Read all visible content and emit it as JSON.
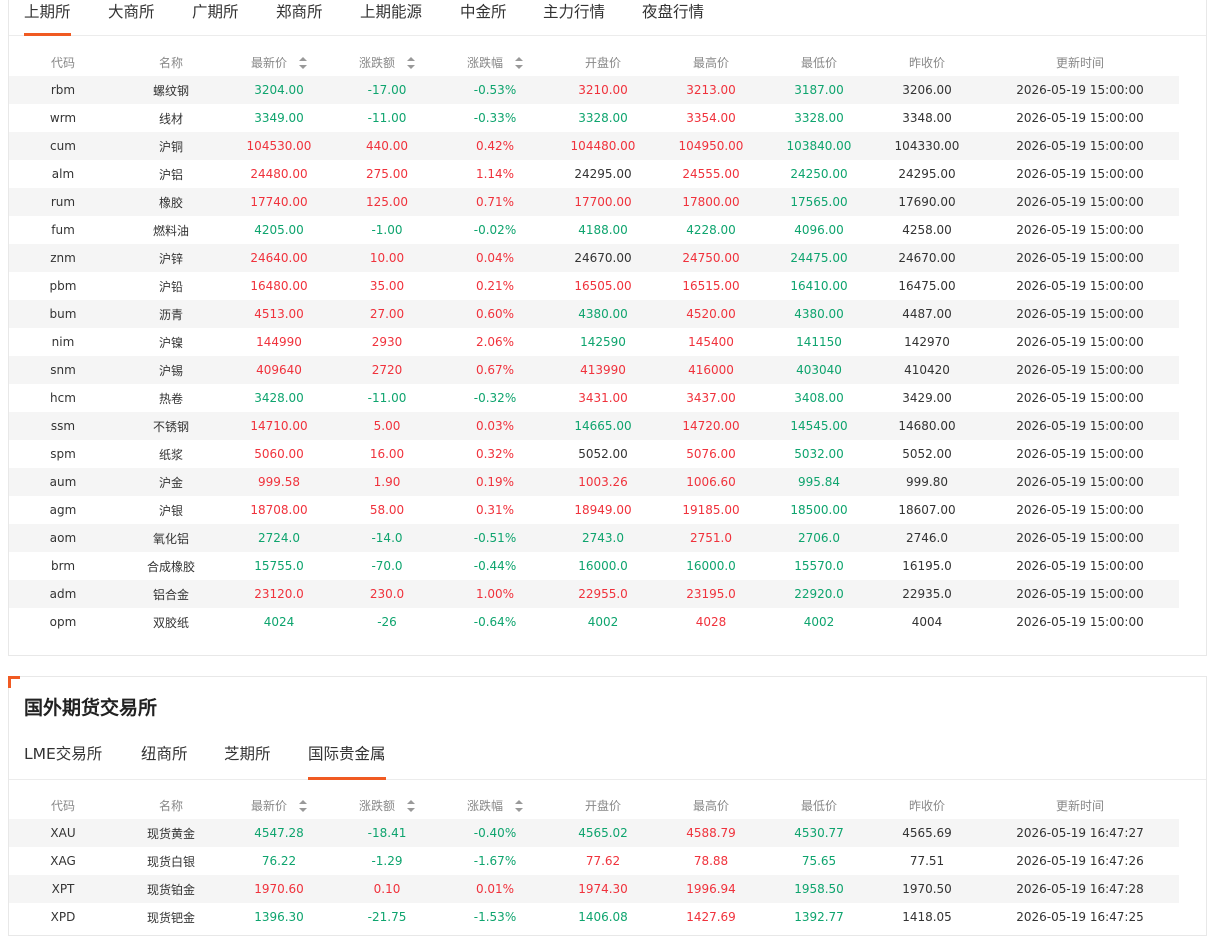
{
  "domestic": {
    "tabs": [
      "上期所",
      "大商所",
      "广期所",
      "郑商所",
      "上期能源",
      "中金所",
      "主力行情",
      "夜盘行情"
    ],
    "active_tab": 0,
    "columns": [
      "代码",
      "名称",
      "最新价",
      "涨跌额",
      "涨跌幅",
      "开盘价",
      "最高价",
      "最低价",
      "昨收价",
      "更新时间"
    ],
    "rows": [
      {
        "code": "rbm",
        "name": "螺纹钢",
        "last": "3204.00",
        "chg": "-17.00",
        "pct": "-0.53%",
        "open": "3210.00",
        "high": "3213.00",
        "low": "3187.00",
        "prev": "3206.00",
        "time": "2026-05-19 15:00:00"
      },
      {
        "code": "wrm",
        "name": "线材",
        "last": "3349.00",
        "chg": "-11.00",
        "pct": "-0.33%",
        "open": "3328.00",
        "high": "3354.00",
        "low": "3328.00",
        "prev": "3348.00",
        "time": "2026-05-19 15:00:00"
      },
      {
        "code": "cum",
        "name": "沪铜",
        "last": "104530.00",
        "chg": "440.00",
        "pct": "0.42%",
        "open": "104480.00",
        "high": "104950.00",
        "low": "103840.00",
        "prev": "104330.00",
        "time": "2026-05-19 15:00:00"
      },
      {
        "code": "alm",
        "name": "沪铝",
        "last": "24480.00",
        "chg": "275.00",
        "pct": "1.14%",
        "open": "24295.00",
        "high": "24555.00",
        "low": "24250.00",
        "prev": "24295.00",
        "time": "2026-05-19 15:00:00"
      },
      {
        "code": "rum",
        "name": "橡胶",
        "last": "17740.00",
        "chg": "125.00",
        "pct": "0.71%",
        "open": "17700.00",
        "high": "17800.00",
        "low": "17565.00",
        "prev": "17690.00",
        "time": "2026-05-19 15:00:00"
      },
      {
        "code": "fum",
        "name": "燃料油",
        "last": "4205.00",
        "chg": "-1.00",
        "pct": "-0.02%",
        "open": "4188.00",
        "high": "4228.00",
        "low": "4096.00",
        "prev": "4258.00",
        "time": "2026-05-19 15:00:00"
      },
      {
        "code": "znm",
        "name": "沪锌",
        "last": "24640.00",
        "chg": "10.00",
        "pct": "0.04%",
        "open": "24670.00",
        "high": "24750.00",
        "low": "24475.00",
        "prev": "24670.00",
        "time": "2026-05-19 15:00:00"
      },
      {
        "code": "pbm",
        "name": "沪铅",
        "last": "16480.00",
        "chg": "35.00",
        "pct": "0.21%",
        "open": "16505.00",
        "high": "16515.00",
        "low": "16410.00",
        "prev": "16475.00",
        "time": "2026-05-19 15:00:00"
      },
      {
        "code": "bum",
        "name": "沥青",
        "last": "4513.00",
        "chg": "27.00",
        "pct": "0.60%",
        "open": "4380.00",
        "high": "4520.00",
        "low": "4380.00",
        "prev": "4487.00",
        "time": "2026-05-19 15:00:00"
      },
      {
        "code": "nim",
        "name": "沪镍",
        "last": "144990",
        "chg": "2930",
        "pct": "2.06%",
        "open": "142590",
        "high": "145400",
        "low": "141150",
        "prev": "142970",
        "time": "2026-05-19 15:00:00"
      },
      {
        "code": "snm",
        "name": "沪锡",
        "last": "409640",
        "chg": "2720",
        "pct": "0.67%",
        "open": "413990",
        "high": "416000",
        "low": "403040",
        "prev": "410420",
        "time": "2026-05-19 15:00:00"
      },
      {
        "code": "hcm",
        "name": "热卷",
        "last": "3428.00",
        "chg": "-11.00",
        "pct": "-0.32%",
        "open": "3431.00",
        "high": "3437.00",
        "low": "3408.00",
        "prev": "3429.00",
        "time": "2026-05-19 15:00:00"
      },
      {
        "code": "ssm",
        "name": "不锈钢",
        "last": "14710.00",
        "chg": "5.00",
        "pct": "0.03%",
        "open": "14665.00",
        "high": "14720.00",
        "low": "14545.00",
        "prev": "14680.00",
        "time": "2026-05-19 15:00:00"
      },
      {
        "code": "spm",
        "name": "纸浆",
        "last": "5060.00",
        "chg": "16.00",
        "pct": "0.32%",
        "open": "5052.00",
        "high": "5076.00",
        "low": "5032.00",
        "prev": "5052.00",
        "time": "2026-05-19 15:00:00"
      },
      {
        "code": "aum",
        "name": "沪金",
        "last": "999.58",
        "chg": "1.90",
        "pct": "0.19%",
        "open": "1003.26",
        "high": "1006.60",
        "low": "995.84",
        "prev": "999.80",
        "time": "2026-05-19 15:00:00"
      },
      {
        "code": "agm",
        "name": "沪银",
        "last": "18708.00",
        "chg": "58.00",
        "pct": "0.31%",
        "open": "18949.00",
        "high": "19185.00",
        "low": "18500.00",
        "prev": "18607.00",
        "time": "2026-05-19 15:00:00"
      },
      {
        "code": "aom",
        "name": "氧化铝",
        "last": "2724.0",
        "chg": "-14.0",
        "pct": "-0.51%",
        "open": "2743.0",
        "high": "2751.0",
        "low": "2706.0",
        "prev": "2746.0",
        "time": "2026-05-19 15:00:00"
      },
      {
        "code": "brm",
        "name": "合成橡胶",
        "last": "15755.0",
        "chg": "-70.0",
        "pct": "-0.44%",
        "open": "16000.0",
        "high": "16000.0",
        "low": "15570.0",
        "prev": "16195.0",
        "time": "2026-05-19 15:00:00"
      },
      {
        "code": "adm",
        "name": "铝合金",
        "last": "23120.0",
        "chg": "230.0",
        "pct": "1.00%",
        "open": "22955.0",
        "high": "23195.0",
        "low": "22920.0",
        "prev": "22935.0",
        "time": "2026-05-19 15:00:00"
      },
      {
        "code": "opm",
        "name": "双胶纸",
        "last": "4024",
        "chg": "-26",
        "pct": "-0.64%",
        "open": "4002",
        "high": "4028",
        "low": "4002",
        "prev": "4004",
        "time": "2026-05-19 15:00:00"
      }
    ]
  },
  "foreign": {
    "title": "国外期货交易所",
    "tabs": [
      "LME交易所",
      "纽商所",
      "芝期所",
      "国际贵金属"
    ],
    "active_tab": 3,
    "columns": [
      "代码",
      "名称",
      "最新价",
      "涨跌额",
      "涨跌幅",
      "开盘价",
      "最高价",
      "最低价",
      "昨收价",
      "更新时间"
    ],
    "rows": [
      {
        "code": "XAU",
        "name": "现货黄金",
        "last": "4547.28",
        "chg": "-18.41",
        "pct": "-0.40%",
        "open": "4565.02",
        "high": "4588.79",
        "low": "4530.77",
        "prev": "4565.69",
        "time": "2026-05-19 16:47:27"
      },
      {
        "code": "XAG",
        "name": "现货白银",
        "last": "76.22",
        "chg": "-1.29",
        "pct": "-1.67%",
        "open": "77.62",
        "high": "78.88",
        "low": "75.65",
        "prev": "77.51",
        "time": "2026-05-19 16:47:26"
      },
      {
        "code": "XPT",
        "name": "现货铂金",
        "last": "1970.60",
        "chg": "0.10",
        "pct": "0.01%",
        "open": "1974.30",
        "high": "1996.94",
        "low": "1958.50",
        "prev": "1970.50",
        "time": "2026-05-19 16:47:28"
      },
      {
        "code": "XPD",
        "name": "现货钯金",
        "last": "1396.30",
        "chg": "-21.75",
        "pct": "-1.53%",
        "open": "1406.08",
        "high": "1427.69",
        "low": "1392.77",
        "prev": "1418.05",
        "time": "2026-05-19 16:47:25"
      }
    ]
  },
  "colors": {
    "up": "#f0323c",
    "down": "#0ea46e",
    "accent": "#f05a22",
    "stripe": "#f5f5f5"
  },
  "icons": {
    "sort": "sort-arrows-icon",
    "corner": "corner-bracket-icon"
  }
}
